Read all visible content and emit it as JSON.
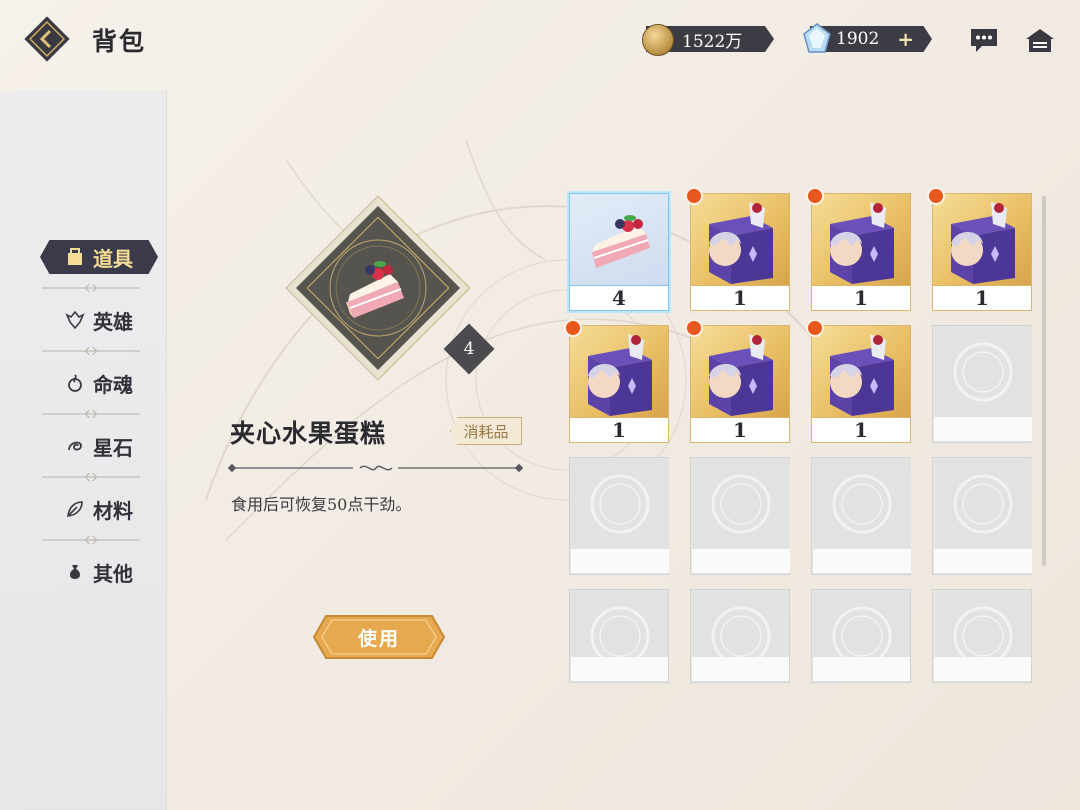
{
  "header": {
    "title": "背包",
    "coins": "1522万",
    "gems": "1902",
    "plus": "+"
  },
  "sidebar": {
    "tabs": [
      {
        "label": "道具",
        "icon": "bag-icon",
        "active": true
      },
      {
        "label": "英雄",
        "icon": "hero-crest-icon",
        "active": false
      },
      {
        "label": "命魂",
        "icon": "soul-icon",
        "active": false
      },
      {
        "label": "星石",
        "icon": "star-stone-icon",
        "active": false
      },
      {
        "label": "材料",
        "icon": "leaf-icon",
        "active": false
      },
      {
        "label": "其他",
        "icon": "pouch-icon",
        "active": false
      }
    ]
  },
  "detail": {
    "count": "4",
    "name": "夹心水果蛋糕",
    "tag": "消耗品",
    "description": "食用后可恢复50点干劲。",
    "use_button": "使用"
  },
  "inventory": {
    "slots": [
      {
        "type": "cake",
        "count": "4",
        "selected": true,
        "new": false
      },
      {
        "type": "character-gift-box",
        "count": "1",
        "selected": false,
        "new": true
      },
      {
        "type": "character-gift-box",
        "count": "1",
        "selected": false,
        "new": true
      },
      {
        "type": "character-gift-box",
        "count": "1",
        "selected": false,
        "new": true
      },
      {
        "type": "character-gift-box",
        "count": "1",
        "selected": false,
        "new": true
      },
      {
        "type": "character-gift-box",
        "count": "1",
        "selected": false,
        "new": true
      },
      {
        "type": "character-gift-box",
        "count": "1",
        "selected": false,
        "new": true
      },
      {
        "type": "empty",
        "count": "",
        "selected": false,
        "new": false
      },
      {
        "type": "empty",
        "count": "",
        "selected": false,
        "new": false
      },
      {
        "type": "empty",
        "count": "",
        "selected": false,
        "new": false
      },
      {
        "type": "empty",
        "count": "",
        "selected": false,
        "new": false
      },
      {
        "type": "empty",
        "count": "",
        "selected": false,
        "new": false
      },
      {
        "type": "empty",
        "count": "",
        "selected": false,
        "new": false
      },
      {
        "type": "empty",
        "count": "",
        "selected": false,
        "new": false
      },
      {
        "type": "empty",
        "count": "",
        "selected": false,
        "new": false
      },
      {
        "type": "empty",
        "count": "",
        "selected": false,
        "new": false
      }
    ]
  },
  "colors": {
    "accent_gold": "#e8bd62",
    "dark_panel": "#3b3a4a",
    "badge_red": "#e8571e",
    "selected_blue": "#7ec6ee"
  }
}
